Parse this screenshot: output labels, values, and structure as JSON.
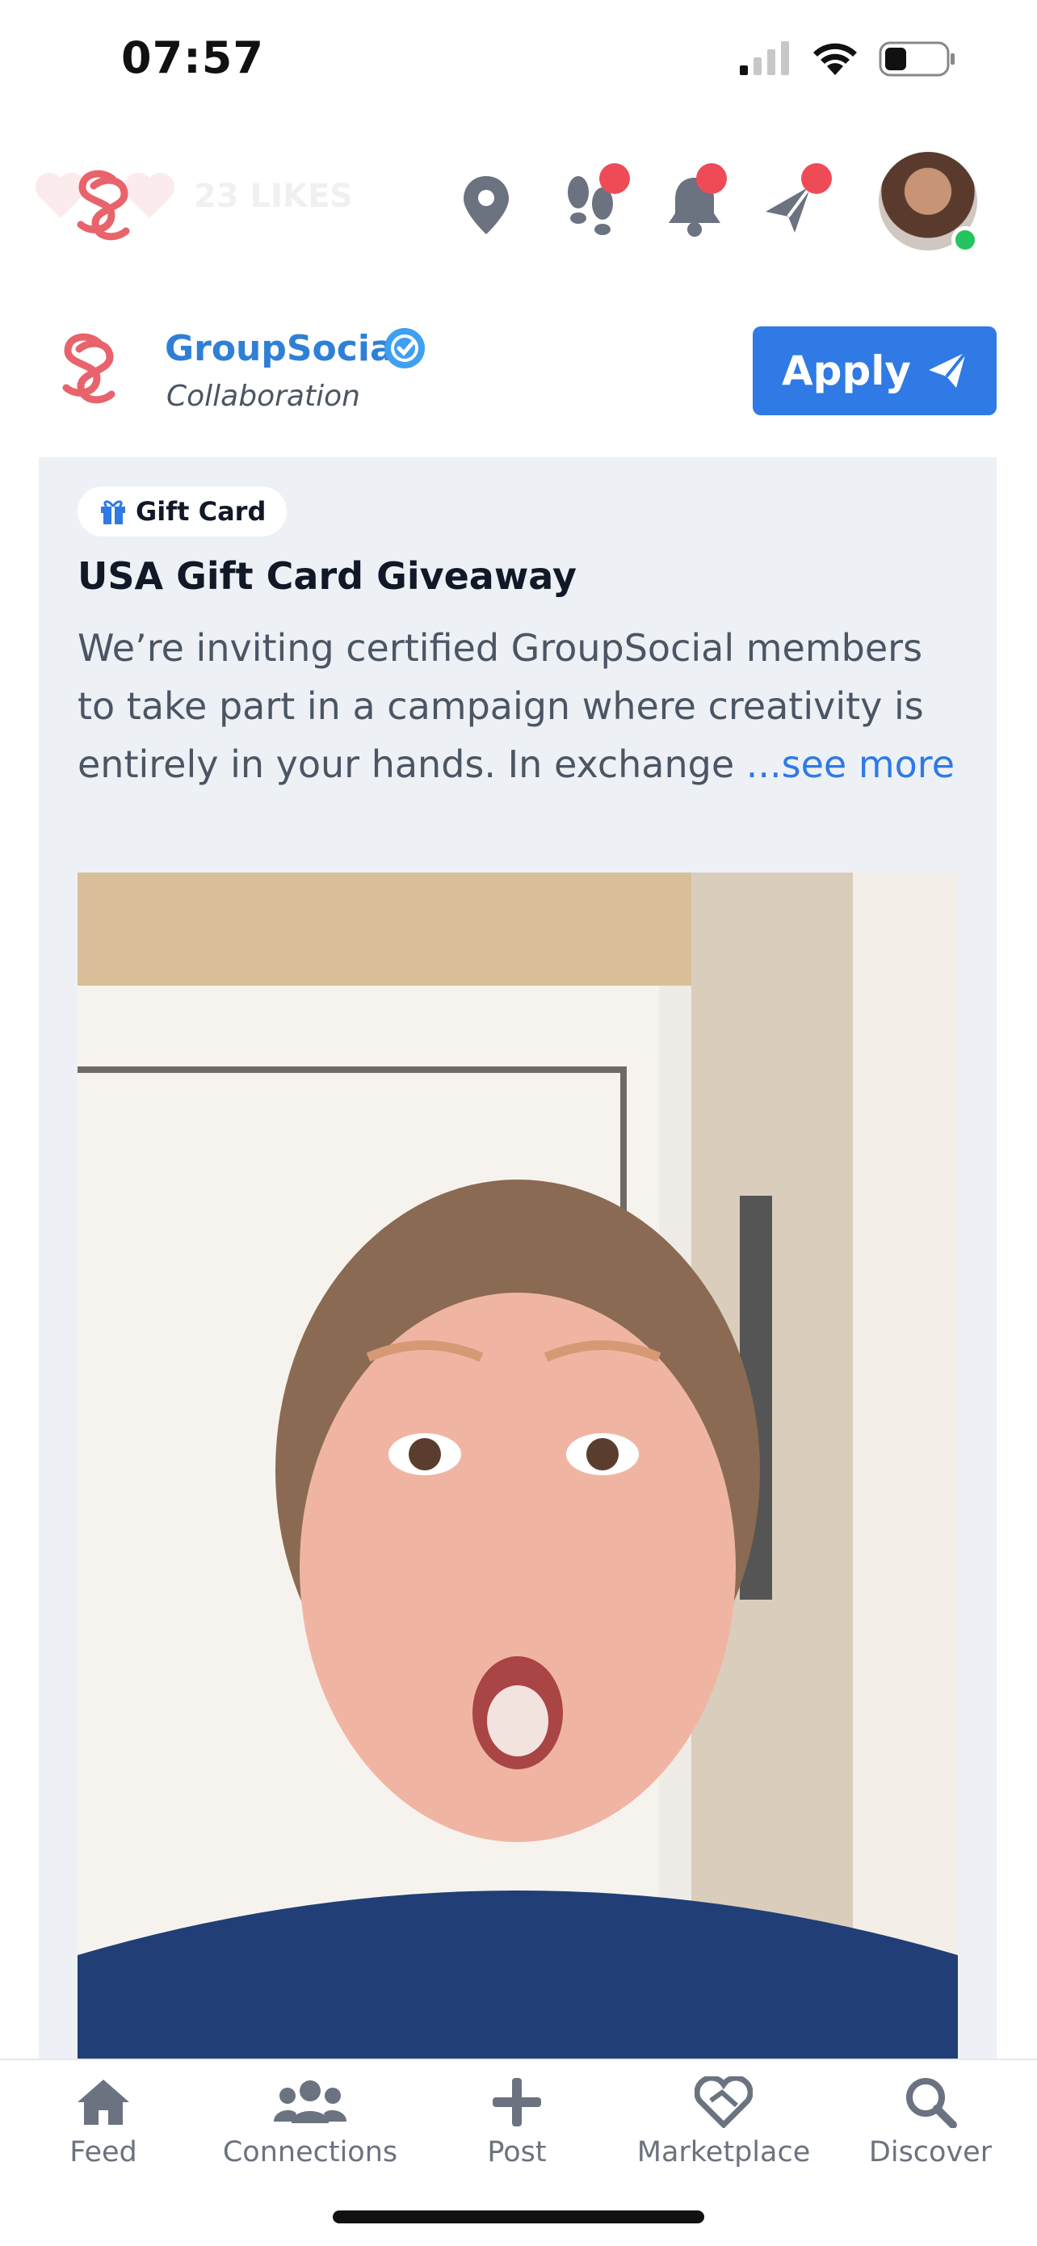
{
  "status_bar": {
    "time": "07:57"
  },
  "app_bar": {
    "likes_text": "23 LIKES",
    "icons": [
      "location-pin-icon",
      "footsteps-icon",
      "bell-icon",
      "rocket-icon"
    ],
    "badge_color": "#ef4b57",
    "online_color": "#22c55e"
  },
  "post": {
    "author": "GroupSocial",
    "category": "Collaboration",
    "apply_label": "Apply",
    "brand_color": "#2f7ae5",
    "logo_color": "#e8636b"
  },
  "card": {
    "tag": "Gift Card",
    "title": "USA Gift Card Giveaway",
    "body": "We’re inviting certified GroupSocial members to take part in a campaign where creativity is entirely in your hands. In exchange ",
    "see_more": "...see more"
  },
  "bottom_nav": {
    "items": [
      {
        "label": "Feed",
        "icon": "home-icon"
      },
      {
        "label": "Connections",
        "icon": "users-icon"
      },
      {
        "label": "Post",
        "icon": "plus-icon"
      },
      {
        "label": "Marketplace",
        "icon": "handshake-icon"
      },
      {
        "label": "Discover",
        "icon": "search-icon"
      }
    ]
  }
}
